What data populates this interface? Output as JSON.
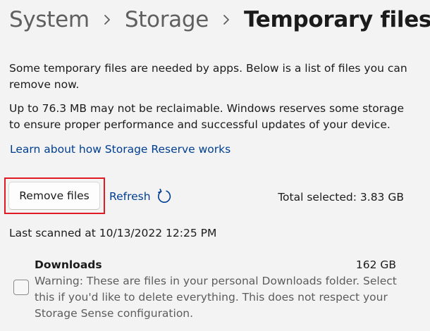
{
  "breadcrumb": {
    "items": [
      "System",
      "Storage",
      "Temporary files"
    ]
  },
  "description": {
    "paragraph1": "Some temporary files are needed by apps. Below is a list of files you can remove now.",
    "paragraph2": "Up to 76.3 MB may not be reclaimable. Windows reserves some storage to ensure proper performance and successful updates of your device.",
    "learn_link": "Learn about how Storage Reserve works"
  },
  "actions": {
    "remove_label": "Remove files",
    "refresh_label": "Refresh",
    "total_selected": "Total selected: 3.83 GB",
    "refresh_icon": "refresh-icon"
  },
  "scan": {
    "last_scanned": "Last scanned at 10/13/2022 12:25 PM"
  },
  "files": [
    {
      "name": "Downloads",
      "size": "162 GB",
      "description": "Warning: These are files in your personal Downloads folder. Select this if you'd like to delete everything. This does not respect your Storage Sense configuration.",
      "checked": false
    }
  ],
  "colors": {
    "background": "#f3f3f3",
    "link": "#003e92",
    "highlight": "#e01b24",
    "breadcrumb_inactive": "#5f5f5f"
  }
}
